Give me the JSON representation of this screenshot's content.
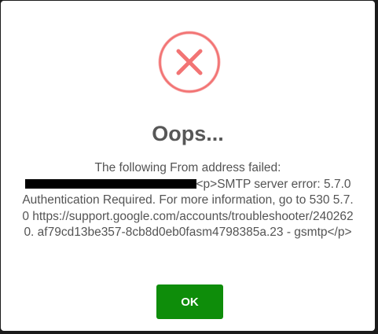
{
  "dialog": {
    "icon": "error-x-circle-icon",
    "icon_color": "#f27474",
    "title": "Oops...",
    "message_part1": "The following From address failed:",
    "message_part2": "<p>SMTP server error: 5.7.0 Authentication Required. For more information, go to 530 5.7.0 https://support.google.com/accounts/troubleshooter/2402620. af79cd13be357-8cb8d0eb0fasm4798385a.23 - gsmtp</p>",
    "ok_label": "OK",
    "ok_color": "#0e8d0a"
  }
}
